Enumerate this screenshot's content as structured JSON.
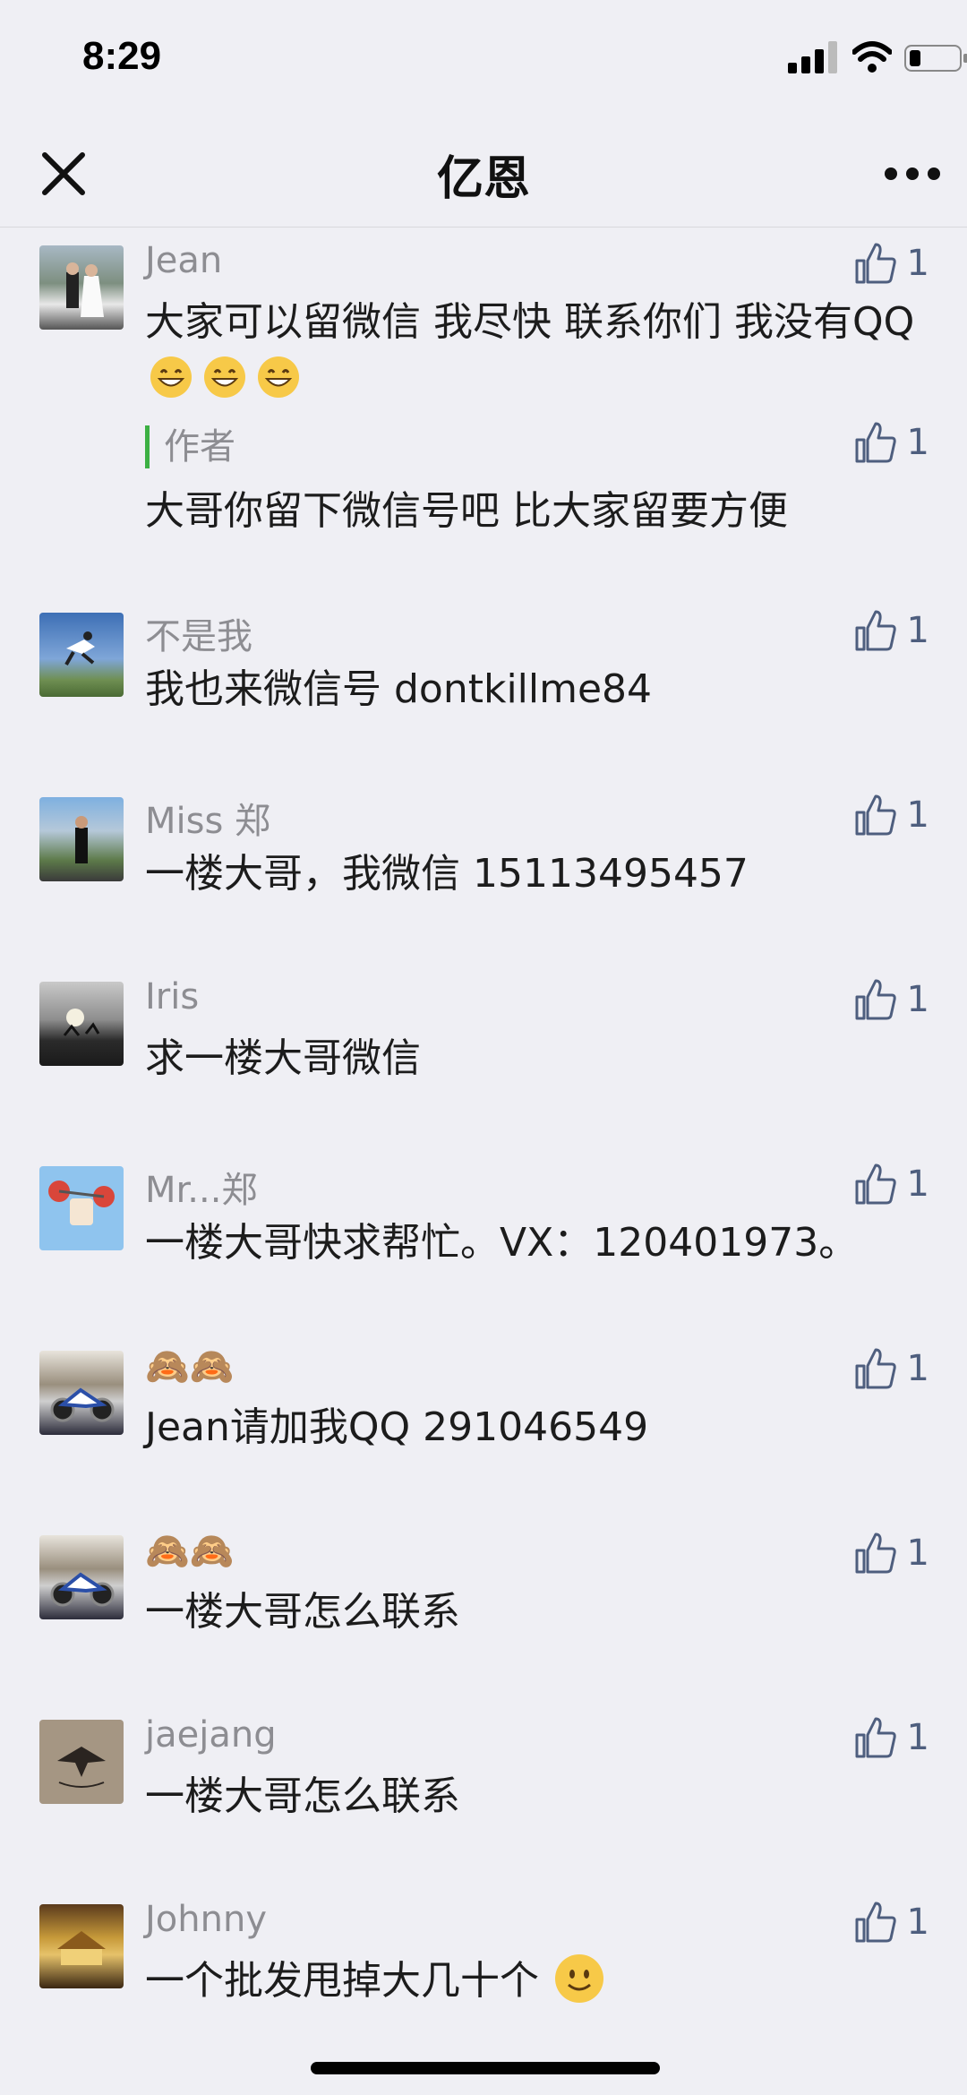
{
  "status": {
    "time": "8:29"
  },
  "nav": {
    "title": "亿恩"
  },
  "comments": [
    {
      "author": "Jean",
      "content": "大家可以留微信 我尽快 联系你们 我没有QQ",
      "likes": "1",
      "reply": {
        "label": "作者",
        "content": "大哥你留下微信号吧  比大家留要方便",
        "likes": "1"
      }
    },
    {
      "author": "不是我",
      "content": "我也来微信号 dontkillme84",
      "likes": "1"
    },
    {
      "author": "Miss 郑",
      "content": "一楼大哥，我微信 15113495457",
      "likes": "1"
    },
    {
      "author": "Iris",
      "content": "求一楼大哥微信",
      "likes": "1"
    },
    {
      "author": "Mr...郑",
      "content": "一楼大哥快求帮忙。VX：120401973。",
      "likes": "1"
    },
    {
      "author": "🙈🙈",
      "content": "Jean请加我QQ  291046549",
      "likes": "1"
    },
    {
      "author": "🙈🙈",
      "content": "一楼大哥怎么联系",
      "likes": "1"
    },
    {
      "author": "jaejang",
      "content": "一楼大哥怎么联系",
      "likes": "1"
    },
    {
      "author": "Johnny",
      "content": "一个批发甩掉大几十个",
      "likes": "1"
    }
  ],
  "icons": {
    "close": "close-icon",
    "more": "more-icon",
    "like": "thumbs-up-icon",
    "grin": "grinning-emoji",
    "smile": "smiling-emoji"
  },
  "colors": {
    "background": "#efeff4",
    "like": "#4e5e7e",
    "reply_bar": "#3cb043"
  }
}
